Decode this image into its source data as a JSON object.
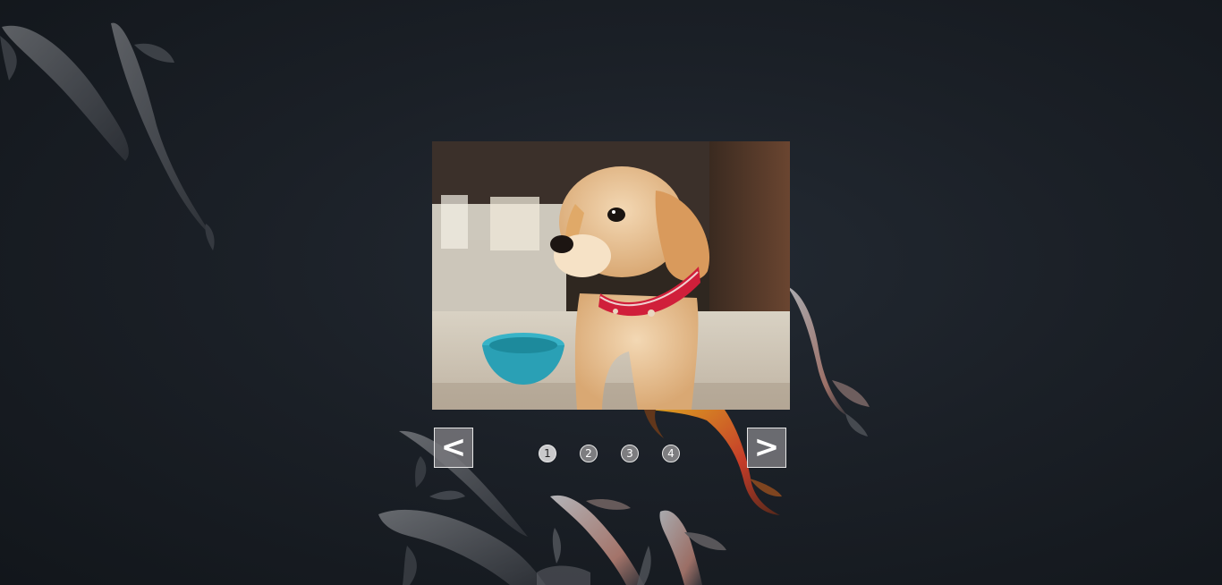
{
  "slider": {
    "prev_label": "<",
    "next_label": ">",
    "current_slide": 1,
    "dots": [
      "1",
      "2",
      "3",
      "4"
    ]
  },
  "icons": {
    "prev": "chevron-left-icon",
    "next": "chevron-right-icon"
  },
  "colors": {
    "background": "#1b2027",
    "button_fill": "#78787c",
    "button_border": "#e6e6e6"
  }
}
